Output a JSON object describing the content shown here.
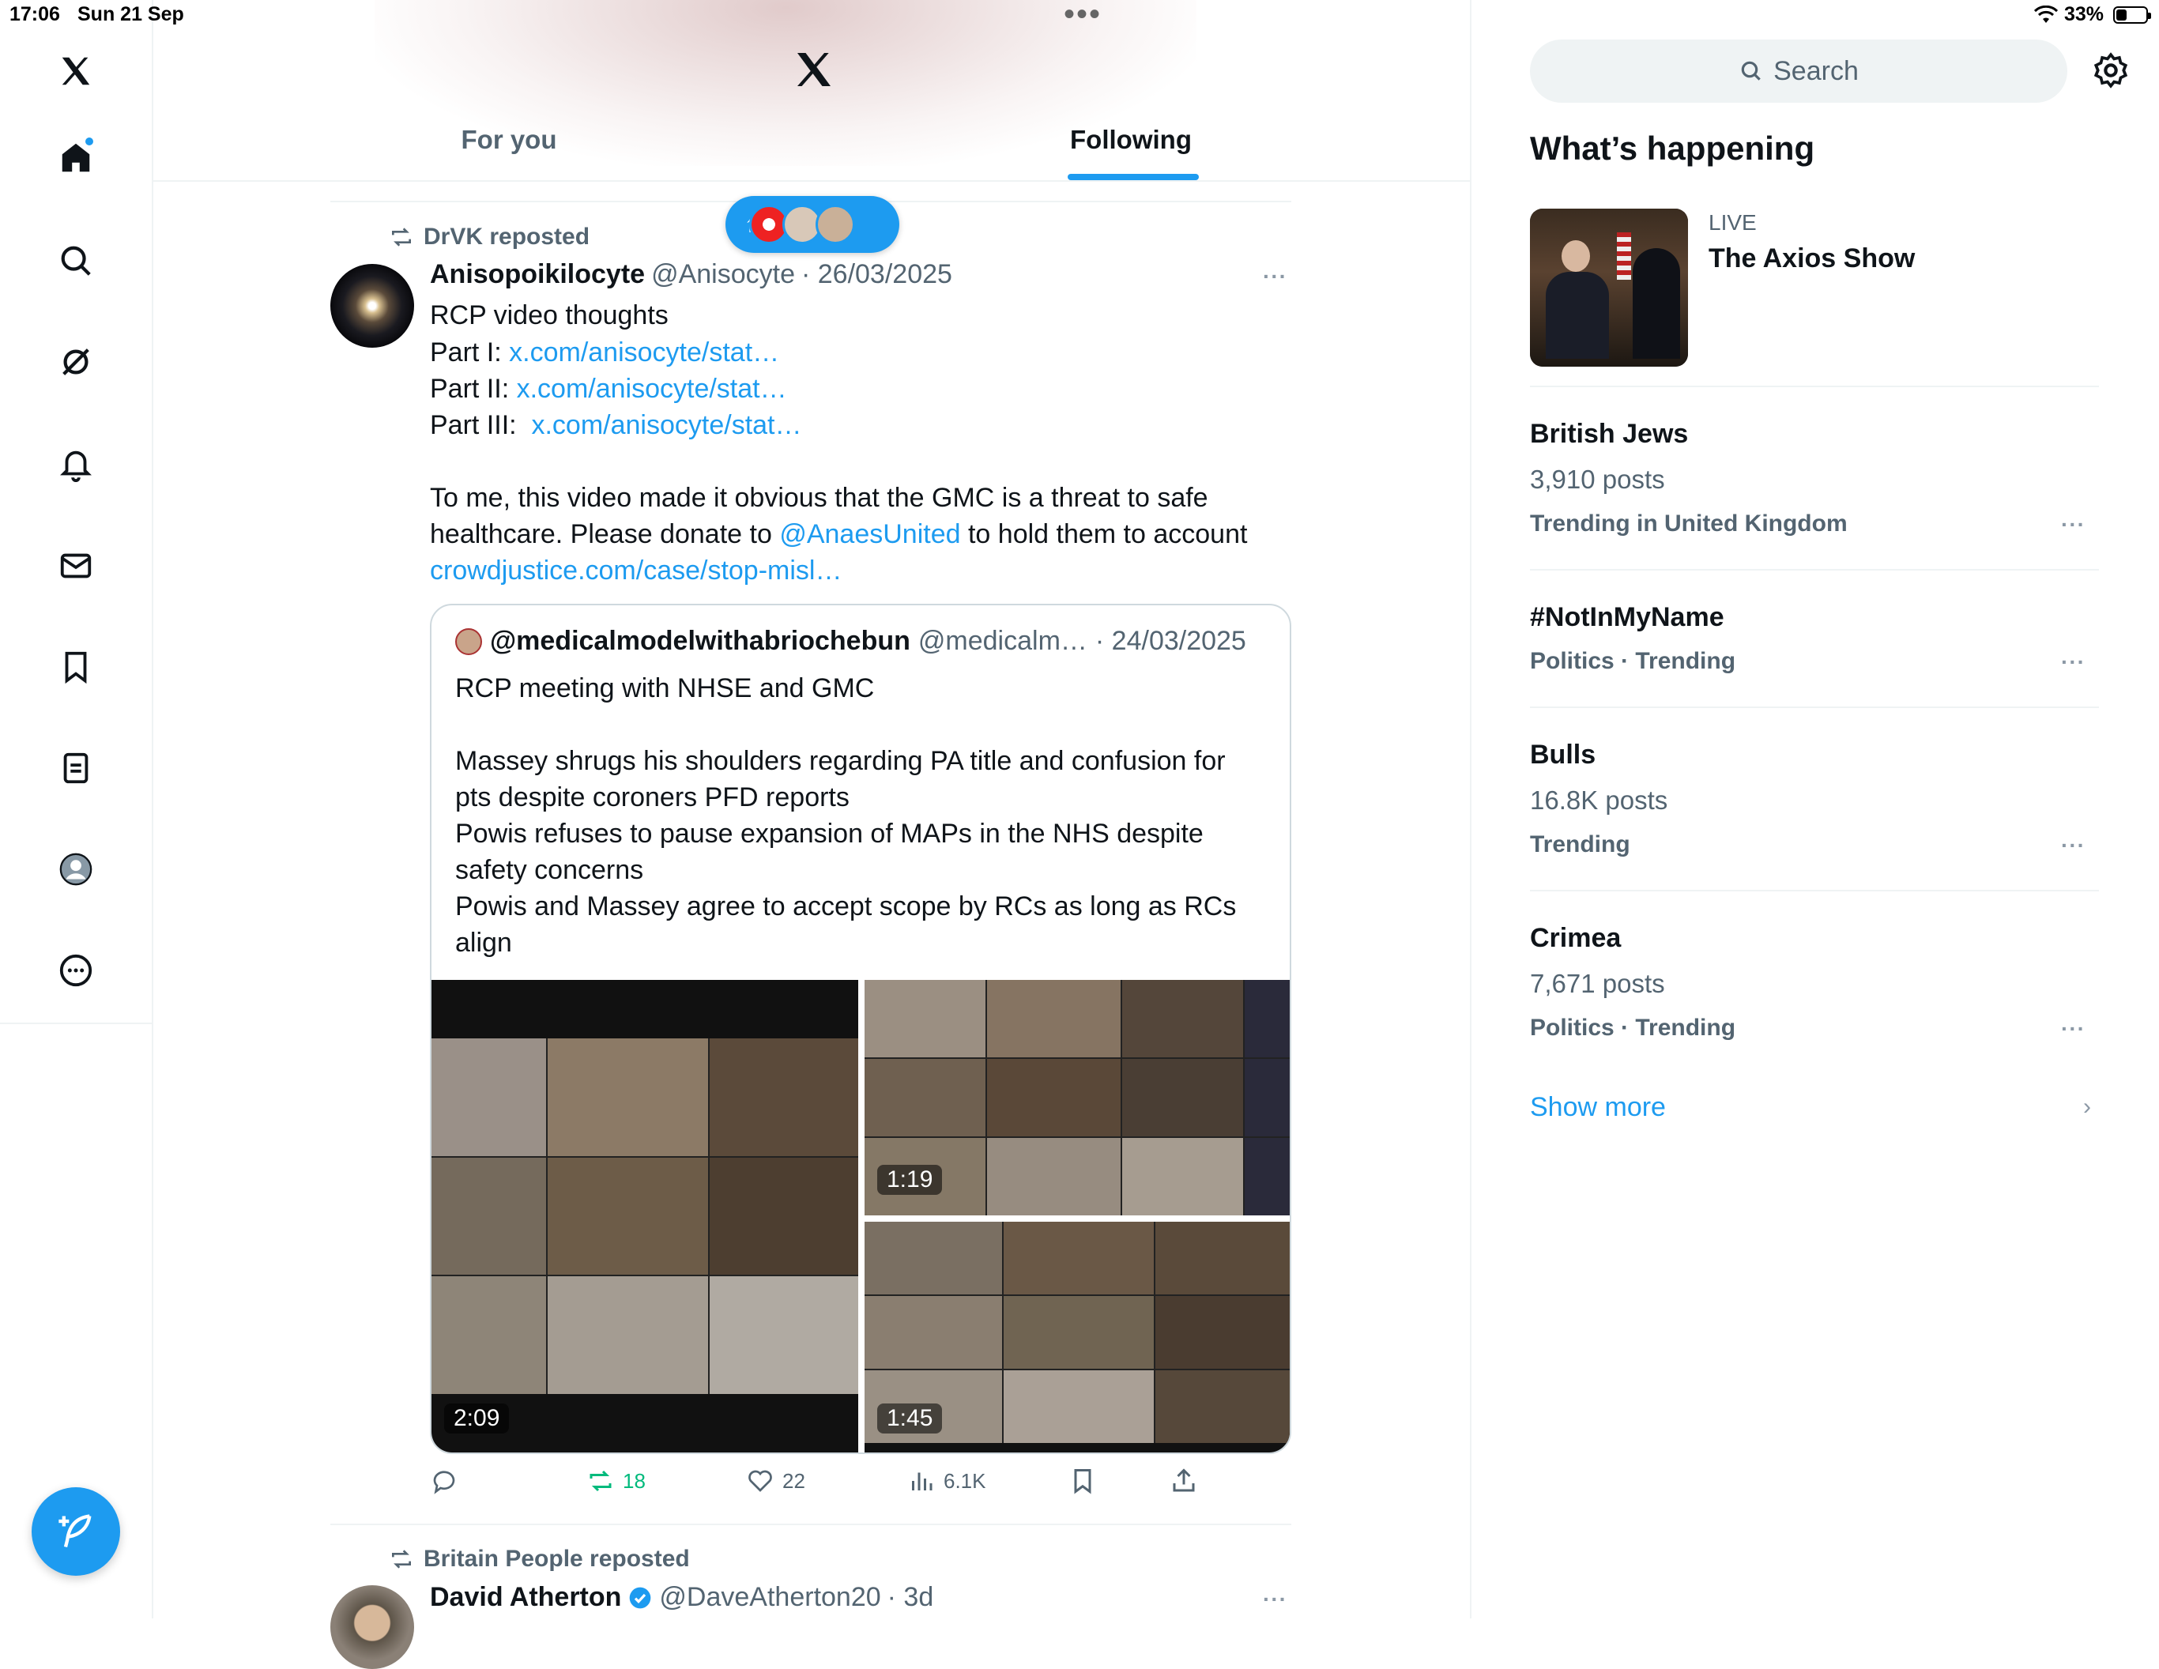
{
  "status_bar": {
    "time": "17:06",
    "date": "Sun 21 Sep",
    "battery": "33%",
    "battery_level": 0.33
  },
  "header": {
    "more": "•••",
    "tabs": [
      {
        "label": "For you"
      },
      {
        "label": "Following"
      }
    ],
    "active_tab": "Following"
  },
  "nav": [
    "home-icon",
    "explore-icon",
    "grok-icon",
    "notifications-icon",
    "messages-icon",
    "bookmarks-icon",
    "lists-icon",
    "profile-icon",
    "more-icon"
  ],
  "compose_icon": "feather-plus-icon",
  "post1": {
    "repost_by": "DrVK reposted",
    "name": "Anisopoikilocyte",
    "handle": "@Anisocyte",
    "date": "· 26/03/2025",
    "more": "···",
    "lines": {
      "l1": "RCP video thoughts",
      "l2_pre": "Part I: ",
      "l2_link": "x.com/anisocyte/stat…",
      "l3_pre": "Part II: ",
      "l3_link": "x.com/anisocyte/stat…",
      "l4_pre": "Part III:  ",
      "l4_link": "x.com/anisocyte/stat…",
      "l5": "To me, this video made it obvious that the GMC is a threat to safe",
      "l6_pre": "healthcare. Please donate to ",
      "l6_link": "@AnaesUnited",
      "l6_post": " to hold them to account",
      "l7_link": "crowdjustice.com/case/stop-misl…"
    },
    "quote": {
      "name": "@medicalmodelwithabriochebun",
      "handle": "@medicalm…",
      "date": "· 24/03/2025",
      "lines": [
        "RCP meeting with NHSE and GMC",
        "Massey shrugs his shoulders regarding PA title and confusion for",
        "pts despite coroners PFD reports",
        "Powis refuses to pause expansion of MAPs in the NHS despite",
        "safety concerns",
        "Powis and Massey agree to accept scope by RCs as long as RCs",
        "align"
      ],
      "videos": [
        {
          "duration": "2:09"
        },
        {
          "duration": "1:19"
        },
        {
          "duration": "1:45"
        }
      ]
    },
    "actions": {
      "reposts": "18",
      "likes": "22",
      "views": "6.1K"
    }
  },
  "post2": {
    "repost_by": "Britain People reposted",
    "name": "David Atherton",
    "handle": "@DaveAtherton20",
    "date": "· 3d",
    "more": "···"
  },
  "sidebar": {
    "search_placeholder": "Search",
    "whats_happening": "What’s happening",
    "live": {
      "label": "LIVE",
      "title": "The Axios Show"
    },
    "trends": [
      {
        "title": "British Jews",
        "posts": "3,910 posts",
        "context": "Trending in United Kingdom"
      },
      {
        "title": "#NotInMyName",
        "context": "Politics · Trending"
      },
      {
        "title": "Bulls",
        "posts": "16.8K posts",
        "context": "Trending"
      },
      {
        "title": "Crimea",
        "posts": "7,671 posts",
        "context": "Politics · Trending"
      }
    ],
    "trend_more": "···",
    "show_more": "Show more",
    "show_more_chevron": "›"
  },
  "colors": {
    "accent": "#1d9bf0",
    "repost_green": "#00ba7c",
    "muted": "#536471"
  }
}
